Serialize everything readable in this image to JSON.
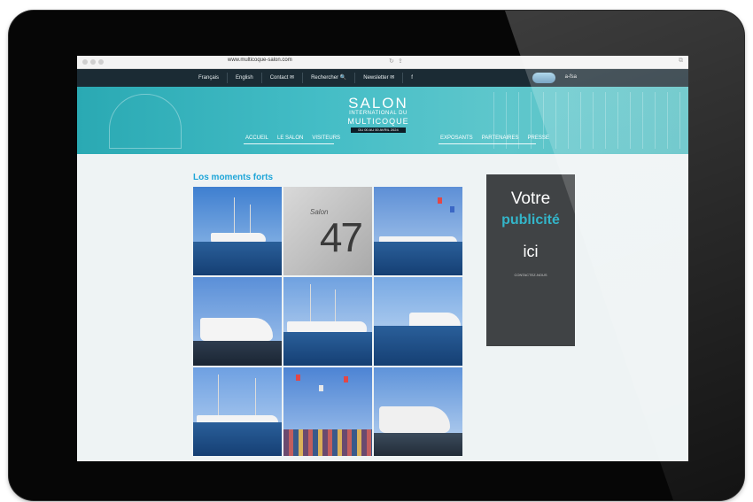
{
  "browser": {
    "url": "www.multicoque-salon.com",
    "icons": [
      "back-icon",
      "forward-icon",
      "reload-icon",
      "share-icon",
      "tabs-icon"
    ]
  },
  "topnav": {
    "items": [
      "Français",
      "English",
      "Contact ✉",
      "Rechercher 🔍",
      "Newsletter ✉",
      "f"
    ],
    "partner_logo_text": "a-fsa"
  },
  "banner": {
    "brand_line1": "SALON",
    "brand_line2": "INTERNATIONAL DU",
    "brand_line3": "MULTICOQUE",
    "dates": "DU 00 AU 00 AVRIL 2024",
    "nav_left": [
      "ACCUEIL",
      "LE SALON",
      "VISITEURS"
    ],
    "nav_right": [
      "EXPOSANTS",
      "PARTENAIRES",
      "PRESSE"
    ]
  },
  "content": {
    "heading": "Los moments forts",
    "gallery": [
      {
        "label": "catamaran-marina"
      },
      {
        "label": "salon-47-sail"
      },
      {
        "label": "harbor-flags"
      },
      {
        "label": "catamaran-bow"
      },
      {
        "label": "dock-catamarans"
      },
      {
        "label": "yacht-reflection"
      },
      {
        "label": "sailboat-pier"
      },
      {
        "label": "crowd-flags"
      },
      {
        "label": "motor-yacht"
      }
    ],
    "tile47_text": "47",
    "tile47_salon": "Salon"
  },
  "ad": {
    "line1": "Votre",
    "line2": "publicité",
    "line3": "ici",
    "line4": "CONTACTEZ-NOUS"
  },
  "colors": {
    "accent": "#1ea5d8",
    "banner": "#44bdc6",
    "topnav": "#1b2b34",
    "ad_bg": "#404345",
    "ad_accent": "#33b5c9"
  }
}
